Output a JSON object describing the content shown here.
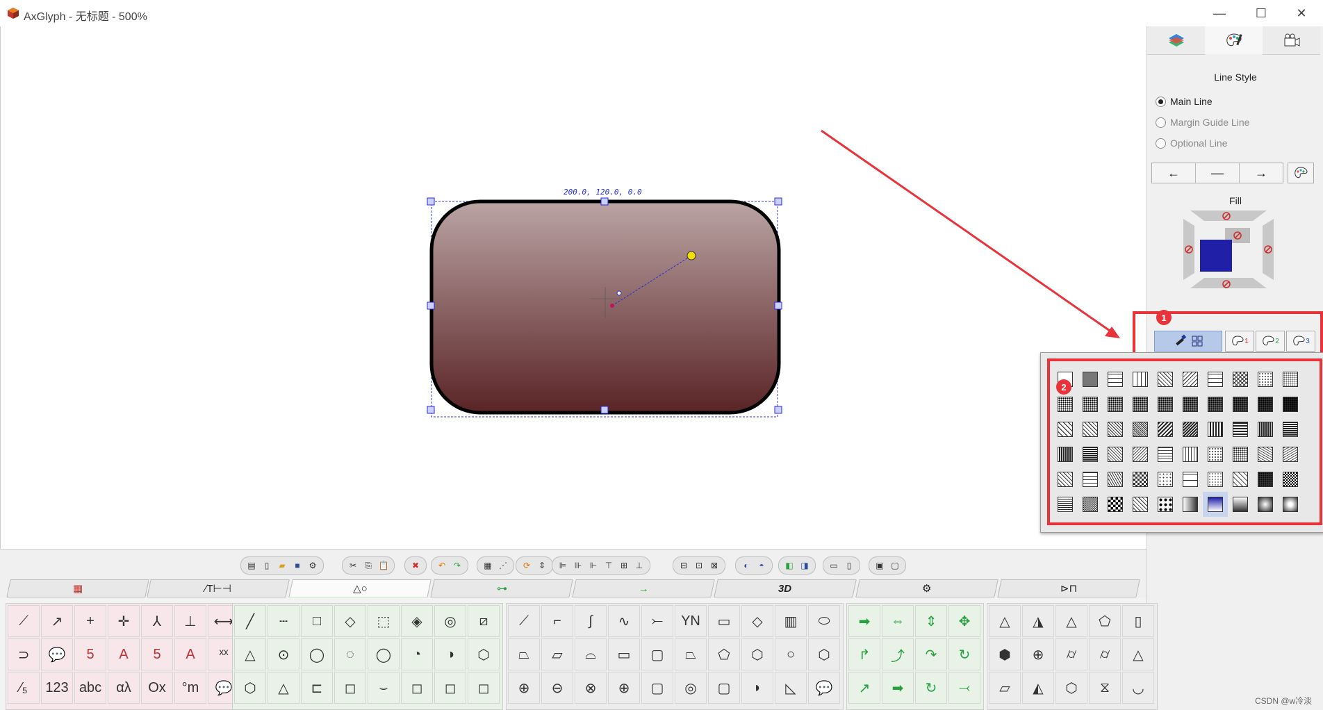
{
  "window": {
    "title": "AxGlyph - 无标题 - 500%",
    "minimize": "—",
    "maximize": "☐",
    "close": "✕"
  },
  "canvas": {
    "coord_label": "200.0, 120.0, 0.0",
    "shape_fill_top": "#bba4a4",
    "shape_fill_bottom": "#5a2426"
  },
  "right_panel": {
    "tabs": [
      "layers-icon",
      "style-palette-icon",
      "camera-icon"
    ],
    "line_style_title": "Line Style",
    "radios": [
      {
        "label": "Main Line",
        "checked": true,
        "enabled": true
      },
      {
        "label": "Margin Guide Line",
        "checked": false,
        "enabled": false
      },
      {
        "label": "Optional Line",
        "checked": false,
        "enabled": false
      }
    ],
    "arrows": [
      "←",
      "—",
      "→"
    ],
    "fill_title": "Fill",
    "fill_color": "#1f1fa8",
    "palette_buttons": [
      "1",
      "2",
      "3"
    ],
    "badge_1": "1",
    "badge_2": "2"
  },
  "pattern_grid": {
    "rows": 6,
    "cols": 10,
    "selected_index": 56
  },
  "library_tabs": [
    "colors",
    "∕T⊢⊣",
    "△○",
    "flow",
    "→",
    "3D",
    "gear",
    "circuit"
  ],
  "library_groups": {
    "g1": [
      "⟋",
      "↗",
      "+",
      "✛",
      "⅄",
      "⊥",
      "⟷",
      "⊃",
      "💬",
      "5",
      "A",
      "5",
      "A",
      "ˣˣ",
      "⁄₅",
      "123",
      "abc",
      "αλ",
      "Ox",
      "°m",
      "💬"
    ],
    "g2": [
      "╱",
      "┄",
      "□",
      "◇",
      "⬚",
      "◈",
      "◎",
      "⧄",
      "△",
      "⊙",
      "◯",
      "◌",
      "◯",
      "◔",
      "◑",
      "⬡",
      "⬡",
      "△",
      "⊏",
      "◻",
      "⌣",
      "◻",
      "◻",
      "◻"
    ],
    "g3": [
      "⟋",
      "⌐",
      "∫",
      "∿",
      "⤚",
      "YN",
      "▭",
      "◇",
      "▥",
      "⬭",
      "⏢",
      "▱",
      "⌓",
      "▭",
      "▢",
      "⏢",
      "⬠",
      "⬡",
      "○",
      "⬡",
      "⊕",
      "⊖",
      "⊗",
      "⊕",
      "▢",
      "◎",
      "▢",
      "◗",
      "◺",
      "💬"
    ],
    "g4": [
      "➡",
      "⇔",
      "⇕",
      "✥",
      "↱",
      "⤴",
      "↷",
      "↻",
      "↗",
      "➡",
      "↻",
      "⤙"
    ],
    "g5": [
      "△",
      "◮",
      "△",
      "⬠",
      "▯",
      "⬢",
      "⊕",
      "⌭",
      "⌭",
      "△",
      "⏥",
      "◭",
      "⬡",
      "⧖",
      "◡"
    ]
  },
  "watermark": "CSDN @w冷淡"
}
